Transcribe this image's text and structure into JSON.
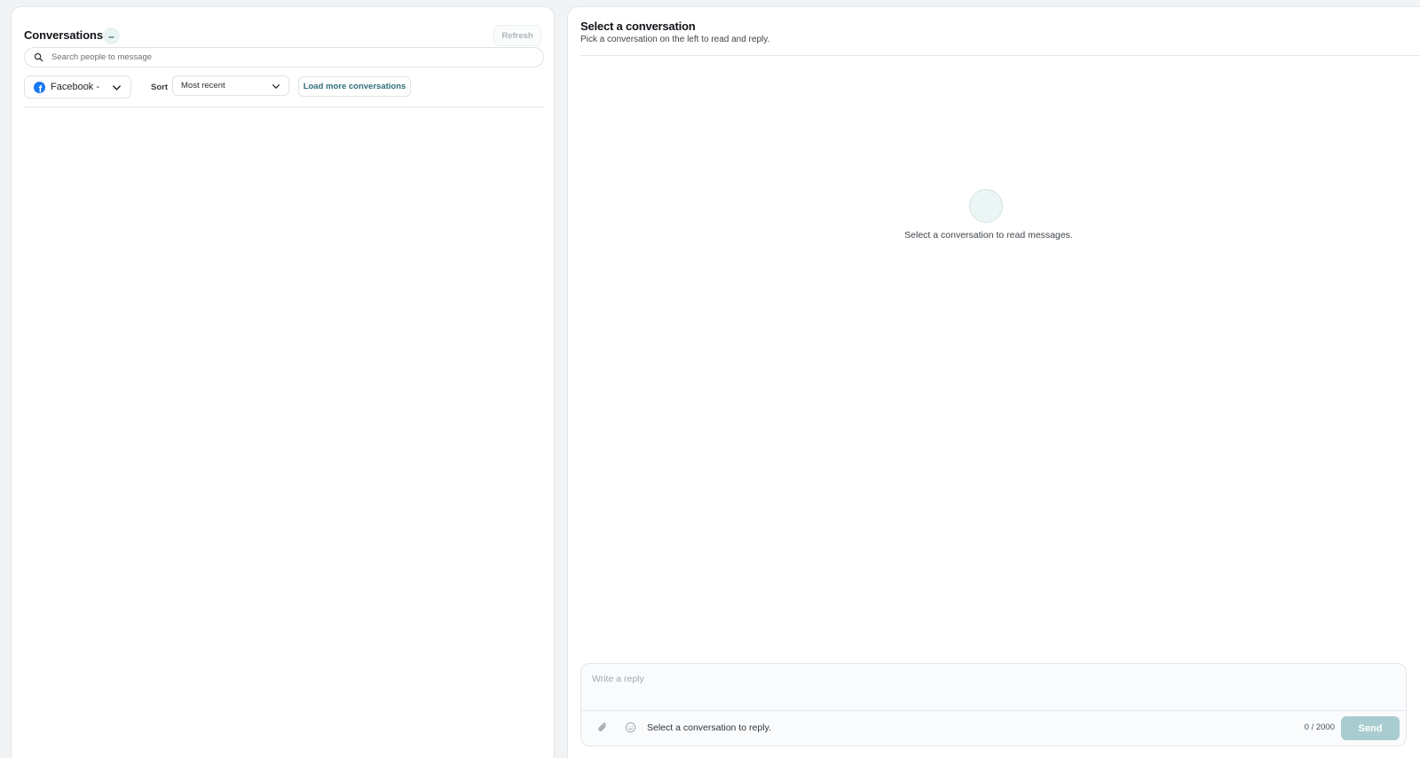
{
  "conversations_panel": {
    "title": "Conversations",
    "count_badge": "–",
    "refresh_label": "Refresh",
    "search": {
      "placeholder": "Search people to message",
      "value": ""
    },
    "account_select": {
      "value": "Facebook - U",
      "icon": "facebook-icon"
    },
    "sort": {
      "label": "Sort",
      "value": "Most recent"
    },
    "load_more_label": "Load more conversations"
  },
  "chat_panel": {
    "title": "Select a conversation",
    "subtitle": "Pick a conversation on the left to read and reply.",
    "empty_state_text": "Select a conversation to read messages.",
    "composer": {
      "placeholder": "Write a reply",
      "value": "",
      "hint": "Select a conversation to reply.",
      "char_count": "0 / 2000",
      "send_label": "Send"
    }
  },
  "colors": {
    "accent": "#2e6f7a",
    "send_disabled": "#a9ccd1",
    "facebook": "#1877f2",
    "background": "#f1f3f5"
  }
}
